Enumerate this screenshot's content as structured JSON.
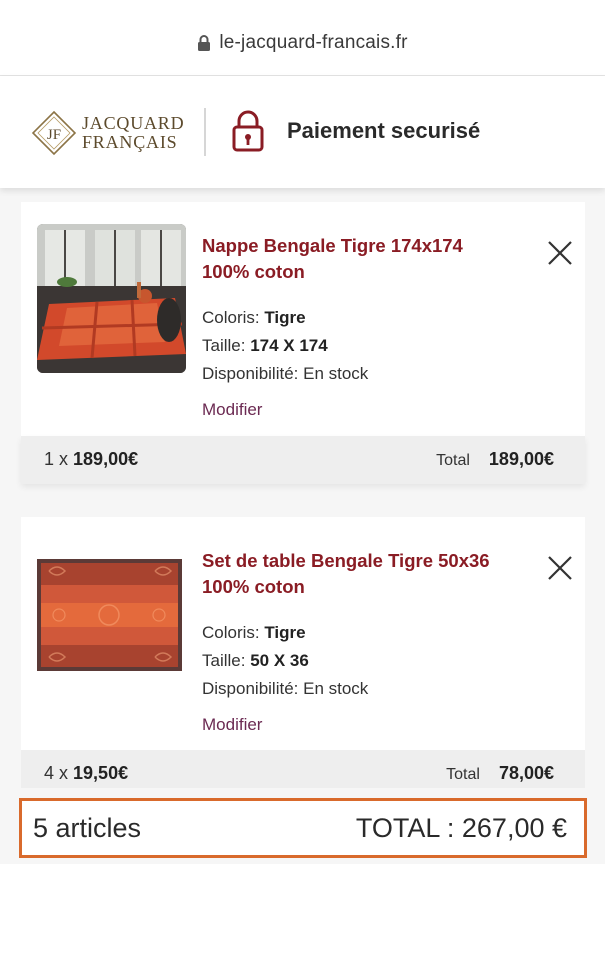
{
  "browser": {
    "url": "le-jacquard-francais.fr"
  },
  "header": {
    "logo_line1": "JACQUARD",
    "logo_line2": "FRANÇAIS",
    "logo_monogram": "JF",
    "title": "Paiement securisé"
  },
  "items": [
    {
      "name_line1": "Nappe Bengale Tigre 174x174",
      "name_line2": "100% coton",
      "color_label": "Coloris:",
      "color_value": "Tigre",
      "size_label": "Taille:",
      "size_value": "174 X 174",
      "availability": "Disponibilité: En stock",
      "modify_label": "Modifier",
      "qty_prefix": "1 x",
      "unit_price": "189,00€",
      "total_label": "Total",
      "total_value": "189,00€"
    },
    {
      "name_line1": "Set de table Bengale Tigre 50x36",
      "name_line2": "100% coton",
      "color_label": "Coloris:",
      "color_value": "Tigre",
      "size_label": "Taille:",
      "size_value": "50 X 36",
      "availability": "Disponibilité: En stock",
      "modify_label": "Modifier",
      "qty_prefix": "4 x",
      "unit_price": "19,50€",
      "total_label": "Total",
      "total_value": "78,00€"
    }
  ],
  "summary": {
    "count": "5 articles",
    "total": "TOTAL : 267,00 €"
  },
  "colors": {
    "product_title": "#8a1c24",
    "modify_link": "#6b2a52",
    "summary_border": "#d96a2c"
  },
  "icons": [
    "lock-icon",
    "padlock-icon",
    "close-icon",
    "jacquard-monogram-logo"
  ]
}
